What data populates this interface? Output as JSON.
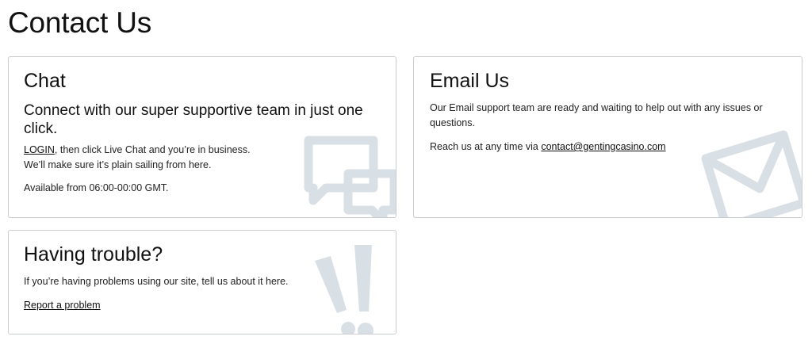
{
  "page": {
    "title": "Contact Us"
  },
  "chat": {
    "heading": "Chat",
    "lead": "Connect with our super supportive team in just one click.",
    "login_link": "LOGIN",
    "line1_rest": ", then click Live Chat and you’re in business.",
    "line2": "We’ll make sure it’s plain sailing from here.",
    "availability": "Available from 06:00-00:00 GMT.",
    "icon": "chat-bubbles-icon"
  },
  "email": {
    "heading": "Email Us",
    "description": "Our Email support team are ready and waiting to help out with any issues or questions.",
    "reach_prefix": "Reach us at any time via ",
    "address": "contact@gentingcasino.com",
    "icon": "envelope-icon"
  },
  "trouble": {
    "heading": "Having trouble?",
    "description": "If you’re having problems using our site, tell us about it here.",
    "report_link": "Report a problem",
    "icon": "exclamation-icon"
  },
  "colors": {
    "card_border": "#c9cdd1",
    "watermark": "#d9e0e5",
    "text": "#111111"
  }
}
